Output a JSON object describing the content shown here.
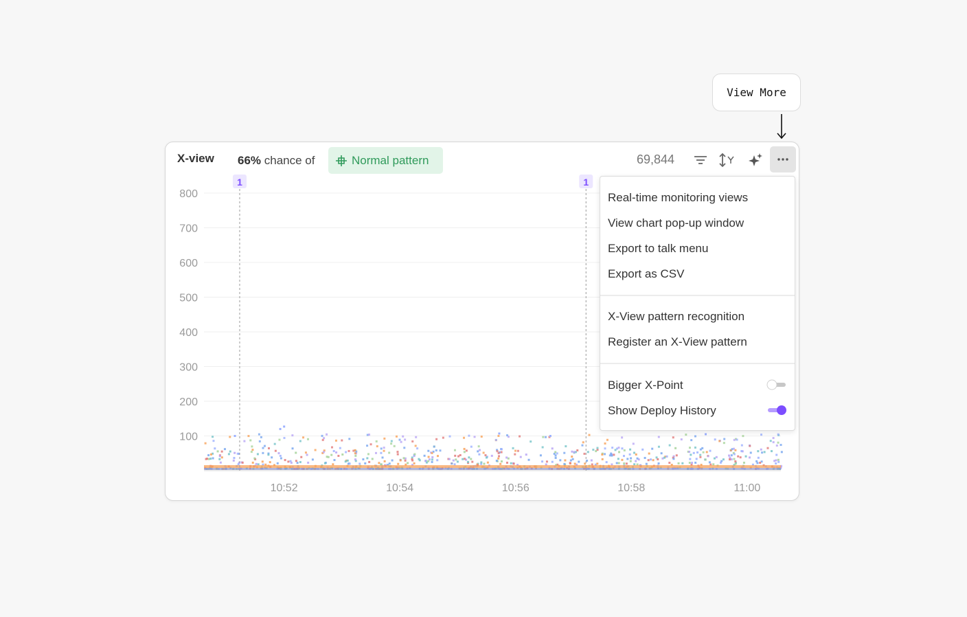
{
  "callout": {
    "label": "View More"
  },
  "card": {
    "title": "X-view",
    "chance_value": "66%",
    "chance_text": "chance of",
    "pattern_badge": "Normal pattern",
    "count": "69,844",
    "toolbar_icons": [
      "filter-icon",
      "y-axis-scale-icon",
      "sparkle-icon",
      "more-icon"
    ]
  },
  "menu": {
    "group1": [
      "Real-time monitoring views",
      "View chart pop-up window",
      "Export to talk menu",
      "Export as CSV"
    ],
    "group2": [
      "X-View pattern recognition",
      "Register an X-View pattern"
    ],
    "toggles": [
      {
        "label": "Bigger X-Point",
        "on": false
      },
      {
        "label": "Show Deploy History",
        "on": true
      }
    ]
  },
  "colors": {
    "accent": "#7c4dff",
    "badge_bg": "#e2f4e8",
    "badge_text": "#2f9a5a",
    "deploy_marker_bg": "#ece6ff"
  },
  "chart_data": {
    "type": "scatter",
    "title": "X-view",
    "ylim": [
      0,
      800
    ],
    "y_ticks": [
      "800",
      "700",
      "600",
      "500",
      "400",
      "300",
      "200",
      "100"
    ],
    "x_ticks": [
      "10:52",
      "10:54",
      "10:56",
      "10:58",
      "11:00"
    ],
    "xlim": [
      "10:50:37",
      "11:00:35"
    ],
    "grid": true,
    "deploy_markers": [
      {
        "label": "1",
        "x": "10:51:14"
      },
      {
        "label": "1",
        "x": "10:57:13"
      }
    ],
    "series_colors": [
      "#f7a25a",
      "#9db1ff",
      "#a7d49b",
      "#b9a6f5",
      "#7aa8f0",
      "#e27c7c",
      "#77c4c9"
    ],
    "total_points": 69844,
    "note_points": "Dense transactions mostly between 0 and 60 ms; sparse outliers up to ~130."
  }
}
